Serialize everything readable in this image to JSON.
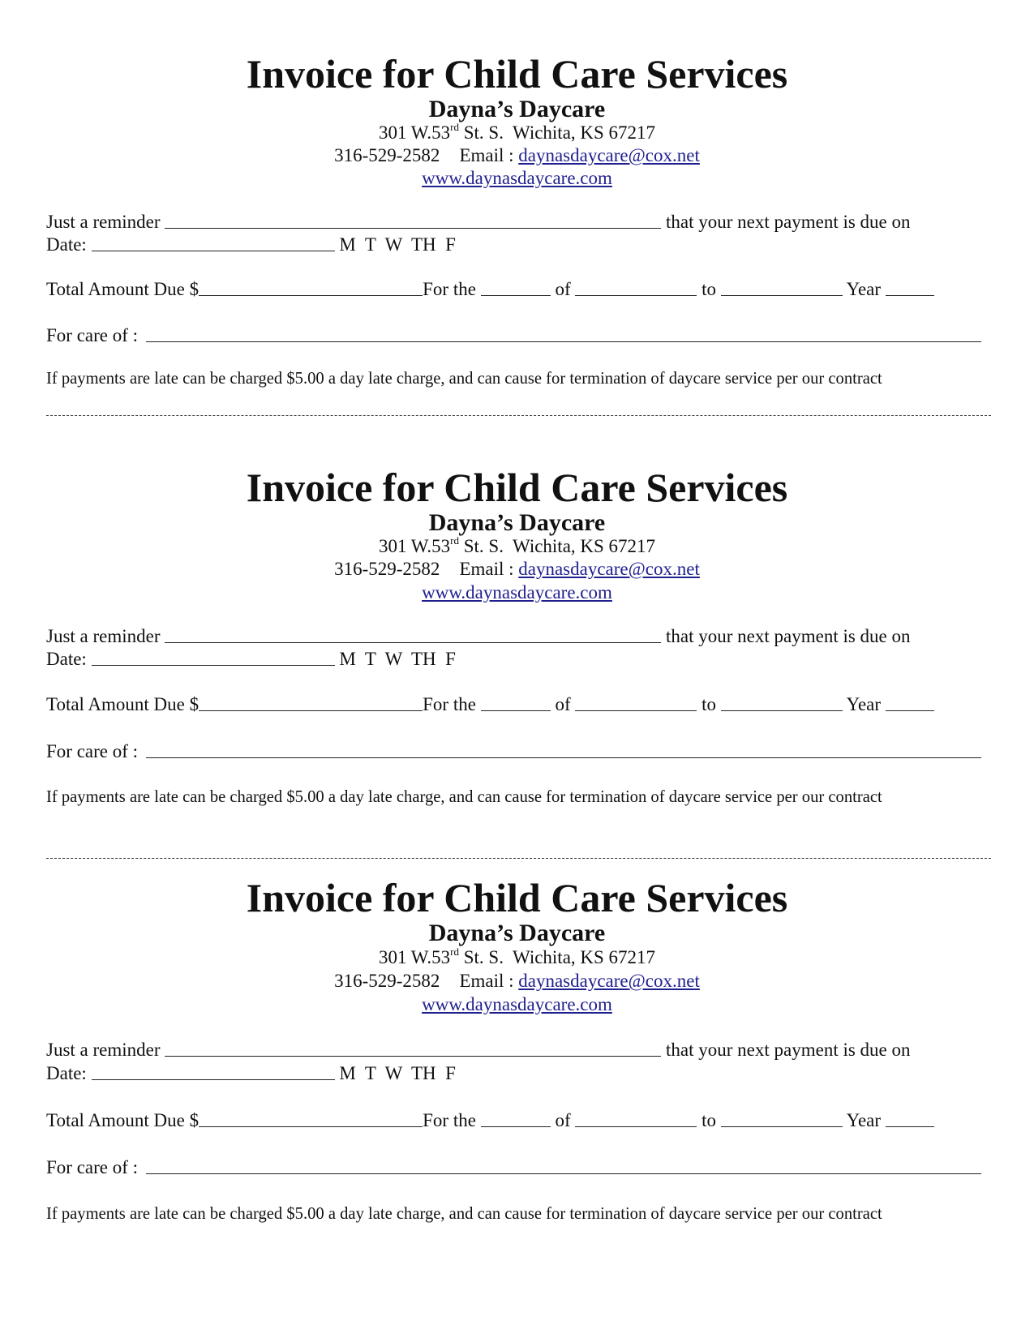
{
  "invoices": [
    {
      "title": "Invoice for Child Care Services",
      "business_name": "Dayna’s Daycare",
      "address_prefix": "301 W.53",
      "address_sup": "rd",
      "address_suffix": " St. S.  Wichita, KS 67217",
      "phone": "316-529-2582",
      "email_label": "Email :",
      "email": "daynasdaycare@cox.net",
      "website": "www.daynasdaycare.com",
      "reminder_label": "Just a reminder",
      "reminder_blank": "_______________________________________________",
      "reminder_suffix": "that your next payment is due on",
      "date_label": "Date:",
      "date_blank": "_______________________",
      "weekdays": "M  T  W  TH  F",
      "total_label": "Total Amount Due $",
      "total_blank": "_____________________",
      "for_the_label": "For the",
      "for_the_blank": "_______",
      "of_label": "of",
      "of_blank": "___________",
      "to_label": "to",
      "to_blank": "___________",
      "year_label": "Year",
      "year_blank": "_____",
      "care_of_label": "For care of :",
      "care_of_blank": "________________________________________________________________________________",
      "late_notice": "If payments are late can be charged $5.00 a day late charge, and can cause for termination of daycare service per our contract"
    },
    {
      "title": "Invoice for Child Care Services",
      "business_name": "Dayna’s Daycare",
      "address_prefix": "301 W.53",
      "address_sup": "rd",
      "address_suffix": " St. S.  Wichita, KS 67217",
      "phone": "316-529-2582",
      "email_label": "Email :",
      "email": "daynasdaycare@cox.net",
      "website": "www.daynasdaycare.com",
      "reminder_label": "Just a reminder",
      "reminder_blank": "_______________________________________________",
      "reminder_suffix": "that your next payment is due on",
      "date_label": "Date:",
      "date_blank": "_______________________",
      "weekdays": "M  T  W  TH  F",
      "total_label": "Total Amount Due $",
      "total_blank": "_____________________",
      "for_the_label": "For the",
      "for_the_blank": "_______",
      "of_label": "of",
      "of_blank": "___________",
      "to_label": "to",
      "to_blank": "___________",
      "year_label": "Year",
      "year_blank": "_____",
      "care_of_label": "For care of :",
      "care_of_blank": "________________________________________________________________________________",
      "late_notice": "If payments are late can be charged $5.00 a day late charge, and can cause for termination of daycare service per our contract"
    },
    {
      "title": "Invoice for Child Care Services",
      "business_name": "Dayna’s Daycare",
      "address_prefix": "301 W.53",
      "address_sup": "rd",
      "address_suffix": " St. S.  Wichita, KS 67217",
      "phone": "316-529-2582",
      "email_label": "Email :",
      "email": "daynasdaycare@cox.net",
      "website": "www.daynasdaycare.com",
      "reminder_label": "Just a reminder",
      "reminder_blank": "_______________________________________________",
      "reminder_suffix": "that your next payment is due on",
      "date_label": "Date:",
      "date_blank": "_______________________",
      "weekdays": "M  T  W  TH  F",
      "total_label": "Total Amount Due $",
      "total_blank": "_____________________",
      "for_the_label": "For the",
      "for_the_blank": "_______",
      "of_label": "of",
      "of_blank": "___________",
      "to_label": "to",
      "to_blank": "___________",
      "year_label": "Year",
      "year_blank": "_____",
      "care_of_label": "For care of :",
      "care_of_blank": "________________________________________________________________________________",
      "late_notice": "If payments are late can be charged $5.00 a day late charge, and can cause for termination of daycare service per our contract"
    }
  ],
  "colors": {
    "text": "#111111",
    "link": "#1f1f8f"
  }
}
